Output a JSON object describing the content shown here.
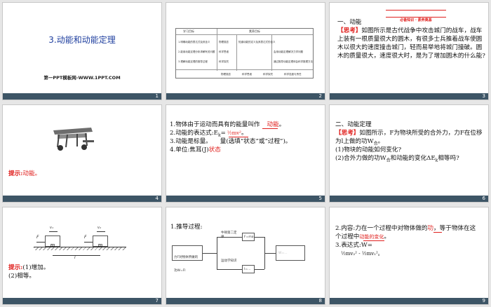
{
  "slides": [
    {
      "number": "1",
      "title": "3.动能和动能定理",
      "subtitle": "第一PPT模板网-WWW.1PPT.COM"
    },
    {
      "number": "2",
      "table_header": [
        "学习目标",
        "素养目标"
      ],
      "table_rows": [
        {
          "left": "1.明确动能的表达式及其含义",
          "right_a": "物理观念",
          "right_b": "知道动能的定义及其表达式的含义"
        },
        {
          "left": "2.能用动能定理分析求解有关问题",
          "right_a": "科学思维",
          "right_b": "会用动能定理解决力学问题"
        },
        {
          "left": "3.理解动能定理的推导过程",
          "right_a": "科学探究",
          "right_b": "通过推导动能定理体会科学推理方法"
        }
      ],
      "table_footer": [
        "物理观念",
        "科学思维",
        "科学探究",
        "科学态度与责任"
      ]
    },
    {
      "number": "3",
      "banner": "必备知识 · 素养奠基",
      "heading": "一、动能",
      "tag": "【思考】",
      "lines": [
        "如图所示是古代战争中攻击城门的战车，战车",
        "上装有一根质量很大的圆木，有很多士兵推着战车使圆",
        "木以很大的速度撞击城门，轻而易举地将城门撞破。圆",
        "木的质量很大，速度很大时，是为了增加圆木的什么能?"
      ]
    },
    {
      "number": "4",
      "hint_label": "提示:",
      "hint_text": "动能。"
    },
    {
      "number": "5",
      "line1_pre": "1.物体由于运动而具有的能量叫作",
      "line1_ans": "动能",
      "line2_pre": "2.动能的表达式:E",
      "line2_sub": "k",
      "line2_eq": "=",
      "line2_ans": "½mv²",
      "line3_pre": "3.动能是标量。",
      "line3_gap": "量(选填“状态”或“过程”)。",
      "line4_pre": "4.单位:焦耳(J)",
      "line4_ans": "状态"
    },
    {
      "number": "6",
      "heading": "二、动能定理",
      "tag": "【思考】",
      "lines": [
        "如图所示，F为物块所受的合外力，力F在位移",
        "为l上做的功W",
        "(1)物块的动能如何变化?",
        "(2)合外力做的功W",
        "和动能的变化ΔE",
        "相等吗?"
      ],
      "sub_a": "合",
      "sub_b": "合",
      "sub_c": "k"
    },
    {
      "number": "7",
      "block1": "m",
      "block2": "m",
      "force": "F",
      "v1": "v₁",
      "v2": "v₂",
      "length": "l",
      "hint_label": "提示:",
      "hint_1": "(1)增加。",
      "hint_2": "(2)相等。"
    },
    {
      "number": "8",
      "heading": "1.推导过程:",
      "left_box": "力F对物体所做的功W=Fl",
      "top_label": "牛顿第二定律",
      "top_box": "F=ma",
      "bottom_label": "运动学知识",
      "bottom_box": "l=...",
      "result": "W=..."
    },
    {
      "number": "9",
      "line1": "2.内容:力在一个过程中对物体做的",
      "line1_ans": "功",
      "line1_rest": "，等于物体在这",
      "line2": "个过程中",
      "line2_ans": "动能的变化",
      "line3": "3.表达式:W=",
      "line4": "½mv₂² - ½mv₁²。"
    }
  ]
}
